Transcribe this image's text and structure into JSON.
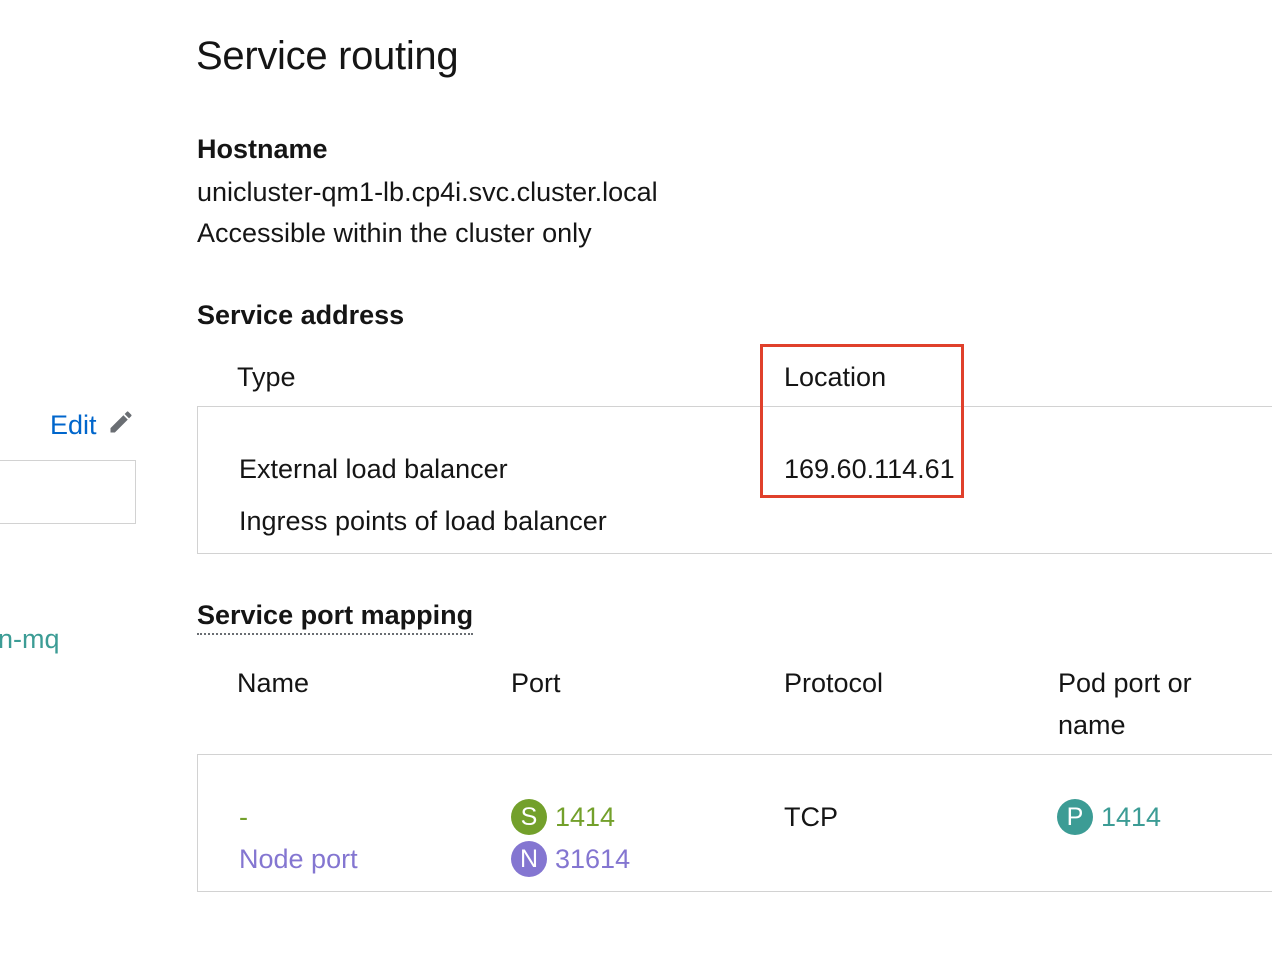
{
  "page": {
    "title": "Service routing"
  },
  "hostname": {
    "heading": "Hostname",
    "value": "unicluster-qm1-lb.cp4i.svc.cluster.local",
    "note": "Accessible within the cluster only"
  },
  "sidebar": {
    "edit_label": "Edit",
    "link_text": "n-mq"
  },
  "service_address": {
    "heading": "Service address",
    "columns": [
      "Type",
      "Location"
    ],
    "rows": [
      {
        "type": "External load balancer",
        "location": "169.60.114.61"
      },
      {
        "type": "Ingress points of load balancer",
        "location": ""
      }
    ]
  },
  "port_mapping": {
    "heading": "Service port mapping",
    "columns": [
      "Name",
      "Port",
      "Protocol",
      "Pod port or",
      "name"
    ],
    "row": {
      "name": "-",
      "node_port_label": "Node port",
      "service_port_badge": "S",
      "service_port": "1414",
      "node_port_badge": "N",
      "node_port": "31614",
      "protocol": "TCP",
      "pod_port_badge": "P",
      "pod_port": "1414"
    }
  },
  "colors": {
    "service_badge": "#73a02b",
    "node_badge": "#8476d1",
    "pod_badge": "#3c9c95",
    "highlight": "#e0402b",
    "link": "#0066cc"
  }
}
